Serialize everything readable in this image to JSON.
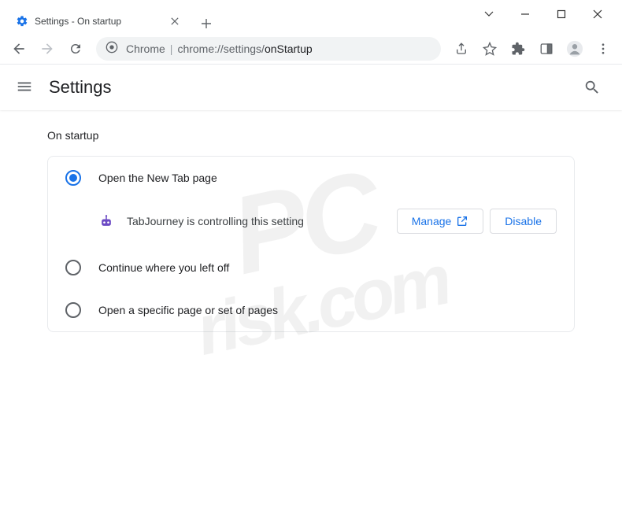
{
  "window": {
    "tab_title": "Settings - On startup"
  },
  "omnibox": {
    "prefix": "Chrome",
    "url_display": "chrome://settings/",
    "url_path": "onStartup"
  },
  "settings_header": {
    "title": "Settings"
  },
  "section": {
    "title": "On startup",
    "options": [
      {
        "label": "Open the New Tab page",
        "selected": true
      },
      {
        "label": "Continue where you left off",
        "selected": false
      },
      {
        "label": "Open a specific page or set of pages",
        "selected": false
      }
    ],
    "extension_notice": {
      "text": "TabJourney is controlling this setting",
      "manage_label": "Manage",
      "disable_label": "Disable"
    }
  },
  "watermark": {
    "main": "PC",
    "sub": "risk.com"
  }
}
